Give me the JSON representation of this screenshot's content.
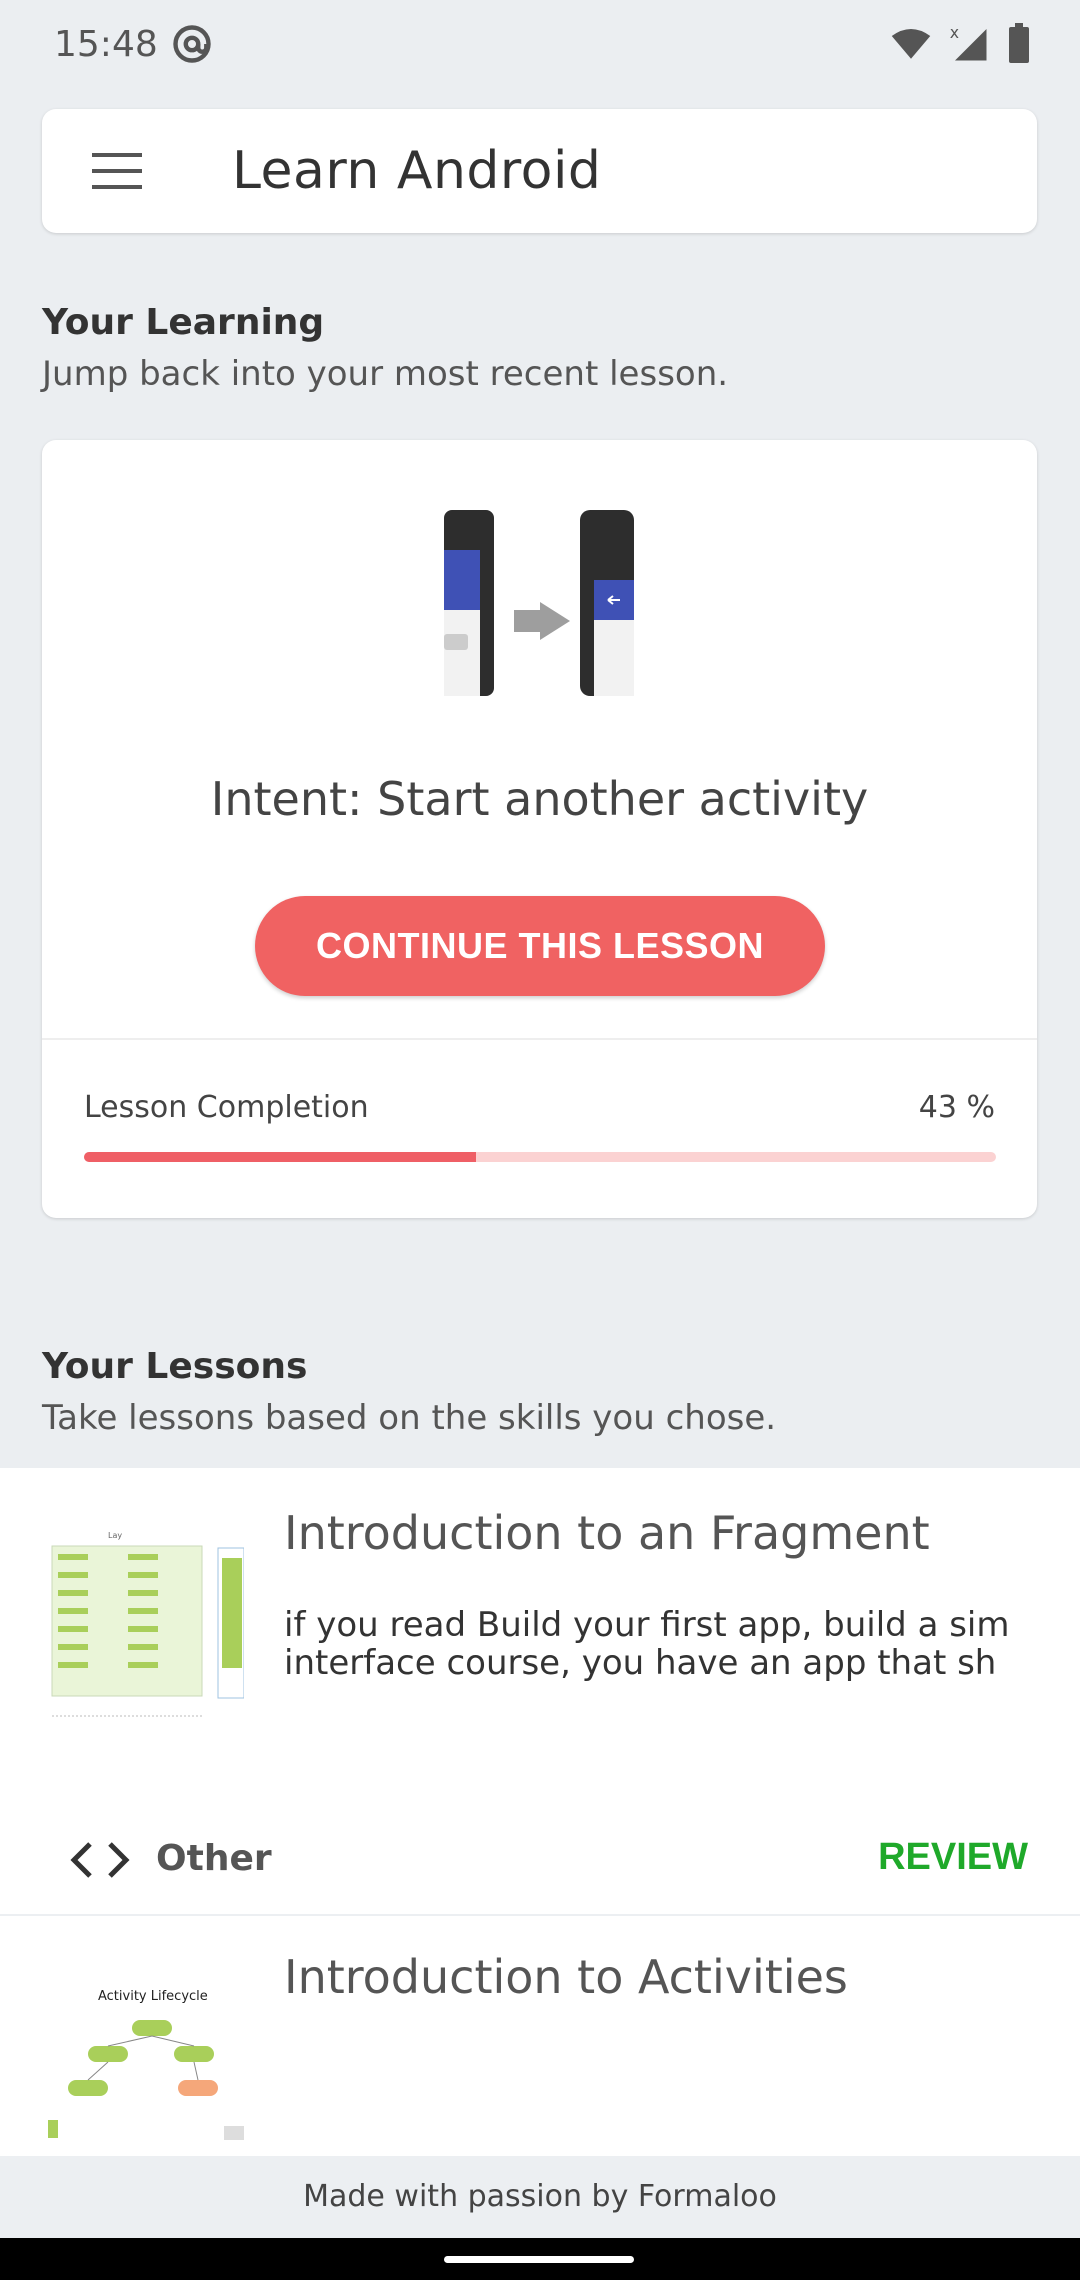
{
  "status_bar": {
    "time": "15:48"
  },
  "app_bar": {
    "title": "Learn Android"
  },
  "your_learning": {
    "title": "Your Learning",
    "subtitle": "Jump back into your most recent lesson.",
    "lesson_name": "Intent: Start another activity",
    "continue_label": "CONTINUE THIS LESSON",
    "completion_label": "Lesson Completion",
    "completion_percent_text": "43 %",
    "completion_fraction": 0.43
  },
  "your_lessons": {
    "title": "Your Lessons",
    "subtitle": "Take lessons based on the skills you chose.",
    "items": [
      {
        "title": "Introduction to an Fragment",
        "desc_line1": "if you read Build your first app, build a sim",
        "desc_line2": "interface course, you have an app that sh",
        "category": "Other",
        "action_label": "REVIEW"
      },
      {
        "title": "Introduction to Activities",
        "thumb_caption": "Activity Lifecycle"
      }
    ]
  },
  "footer": {
    "made_with": "Made with passion by Formaloo"
  },
  "colors": {
    "accent": "#f06262",
    "progress_track": "#fbd2d2",
    "review_green": "#1fa92a",
    "background": "#ebeef1"
  },
  "icons": [
    "menu-icon",
    "at-sign-icon",
    "wifi-icon",
    "cellular-signal-icon",
    "battery-icon",
    "code-icon"
  ]
}
